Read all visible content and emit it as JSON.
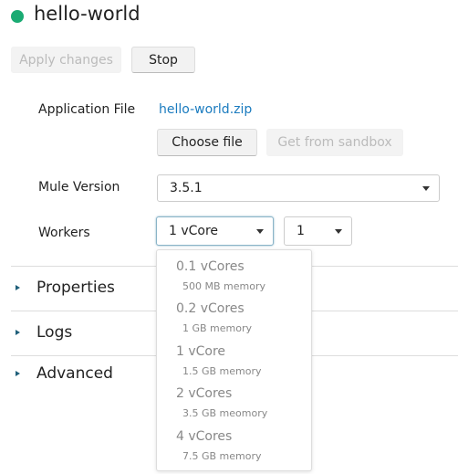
{
  "app": {
    "title": "hello-world",
    "status_color": "#1aab73"
  },
  "toolbar": {
    "apply_label": "Apply changes",
    "stop_label": "Stop"
  },
  "form": {
    "app_file_label": "Application File",
    "app_file_value": "hello-world.zip",
    "choose_file_label": "Choose file",
    "sandbox_label": "Get from sandbox",
    "mule_version_label": "Mule Version",
    "mule_version_value": "3.5.1",
    "workers_label": "Workers",
    "worker_size_value": "1 vCore",
    "worker_count_value": "1"
  },
  "worker_size_options": [
    {
      "label": "0.1 vCores",
      "memory": "500 MB memory"
    },
    {
      "label": "0.2 vCores",
      "memory": "1 GB memory"
    },
    {
      "label": "1 vCore",
      "memory": "1.5 GB memory"
    },
    {
      "label": "2 vCores",
      "memory": "3.5 GB meomory"
    },
    {
      "label": "4 vCores",
      "memory": "7.5 GB memory"
    }
  ],
  "sections": [
    {
      "label": "Properties"
    },
    {
      "label": "Logs"
    },
    {
      "label": "Advanced"
    }
  ]
}
